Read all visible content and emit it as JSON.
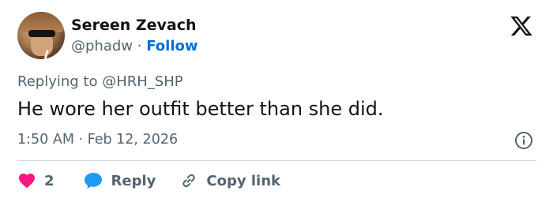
{
  "author": {
    "name": "Sereen Zevach",
    "handle": "@phadw",
    "separator": "·",
    "follow_label": "Follow"
  },
  "reply_to": "Replying to @HRH_SHP",
  "tweet": {
    "text": "He wore her outfit better than she did.",
    "timestamp": "1:50 AM · Feb 12, 2026"
  },
  "actions": {
    "like_count": "2",
    "reply_label": "Reply",
    "copy_link_label": "Copy link"
  },
  "icons": {
    "logo": "x-logo-icon",
    "info": "info-icon",
    "like": "heart-icon",
    "reply": "speech-bubble-icon",
    "copy": "link-icon"
  },
  "colors": {
    "heart": "#f91880",
    "reply_bubble": "#1d9bf0",
    "follow_link": "#006fd6",
    "secondary_text": "#536471",
    "primary_text": "#0f1419"
  }
}
